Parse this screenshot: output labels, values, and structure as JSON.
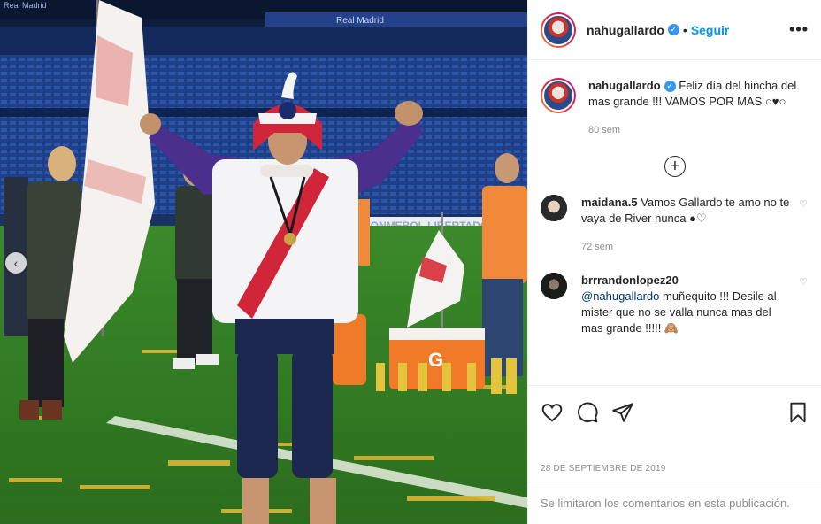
{
  "post": {
    "username": "nahugallardo",
    "follow_label": "Seguir",
    "more_label": "•••",
    "nav_prev_label": "‹",
    "stadium_text_top": "Real Madrid",
    "stadium_text_banner": "Real Madrid",
    "board_text": "CONMEBOL LIBERTADORES 2018"
  },
  "caption": {
    "username": "nahugallardo",
    "text": "Feliz día del hincha del mas grande !!! VAMOS POR MAS ○♥○",
    "time": "80 sem"
  },
  "load_more_label": "+",
  "comments": [
    {
      "username": "maidana.5",
      "text": "Vamos Gallardo te amo no te vaya de River nunca ●♡",
      "time": "72 sem"
    },
    {
      "username": "brrrandonlopez20",
      "mention": "@nahugallardo",
      "text": " muñequito !!! Desile al mister que no se valla nunca mas del mas grande !!!!! 🙈"
    }
  ],
  "icons": {
    "like": "heart-icon",
    "comment": "comment-icon",
    "share": "share-icon",
    "save": "bookmark-icon",
    "verified": "verified-badge-icon"
  },
  "date": "28 DE SEPTIEMBRE DE 2019",
  "comments_limited": "Se limitaron los comentarios en esta publicación.",
  "colors": {
    "accent": "#0095f6",
    "verified": "#3897f0",
    "muted": "#8e8e8e",
    "pitch": "#3f8a2a",
    "stands": "#1d3a78"
  }
}
